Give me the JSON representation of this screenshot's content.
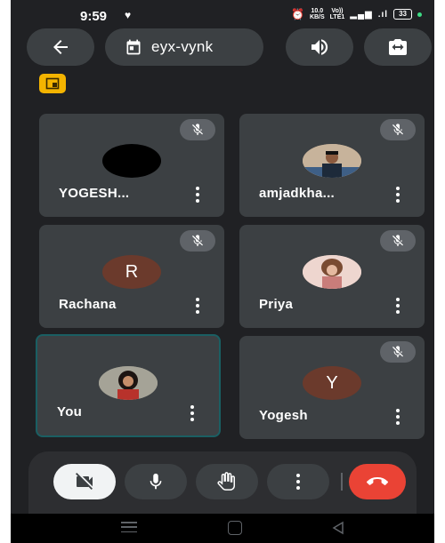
{
  "status_bar": {
    "time": "9:59",
    "speed_value": "10.0",
    "speed_unit": "KB/S",
    "net_1": "Vo))",
    "net_2": "LTE1",
    "battery": "33"
  },
  "header": {
    "meeting_code": "eyx-vynk"
  },
  "participants": [
    {
      "name": "YOGESH...",
      "muted": true,
      "avatar": "black-circle"
    },
    {
      "name": "amjadkha...",
      "muted": true,
      "avatar": "photo"
    },
    {
      "name": "Rachana",
      "muted": true,
      "avatar_letter": "R"
    },
    {
      "name": "Priya",
      "muted": true,
      "avatar": "photo"
    },
    {
      "name": "You",
      "muted": false,
      "avatar": "photo",
      "active_speaker": true
    },
    {
      "name": "Yogesh",
      "muted": true,
      "avatar_letter": "Y"
    }
  ],
  "colors": {
    "background": "#202124",
    "tile": "#3c4043",
    "letter_avatar": "#6b3a2c",
    "end_call": "#ea4335",
    "mini_badge": "#f4b400"
  },
  "icons": {
    "back": "arrow-left-icon",
    "calendar": "calendar-icon",
    "speaker": "speaker-icon",
    "camera_switch": "camera-switch-icon",
    "mic_off": "mic-off-icon",
    "video_off": "video-off-icon",
    "mic": "mic-icon",
    "hand": "raise-hand-icon",
    "more": "more-vertical-icon",
    "end": "end-call-icon"
  }
}
